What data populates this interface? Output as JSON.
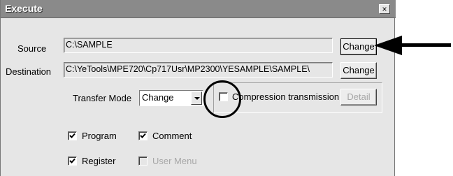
{
  "window": {
    "title": "Execute",
    "close_glyph": "×"
  },
  "source": {
    "label": "Source",
    "value": "C:\\SAMPLE",
    "change_label": "Change"
  },
  "destination": {
    "label": "Destination",
    "value": "C:\\YeTools\\MPE720\\Cp717Usr\\MP2300\\YESAMPLE\\SAMPLE\\",
    "change_label": "Change"
  },
  "transfer_mode": {
    "label": "Transfer Mode",
    "selected": "Change"
  },
  "compression": {
    "label": "Compression transmission",
    "checked": false,
    "detail_label": "Detail"
  },
  "options": [
    {
      "label": "Program",
      "checked": true,
      "enabled": true
    },
    {
      "label": "Comment",
      "checked": true,
      "enabled": true
    },
    {
      "label": "Register",
      "checked": true,
      "enabled": true
    },
    {
      "label": "User Menu",
      "checked": false,
      "enabled": false
    }
  ],
  "annotations": {
    "highlight": "circle",
    "pointer": "arrow"
  },
  "colors": {
    "titlebar": "#8a8a8a",
    "dialog": "#e6e6e6",
    "annotation": "#000000"
  }
}
